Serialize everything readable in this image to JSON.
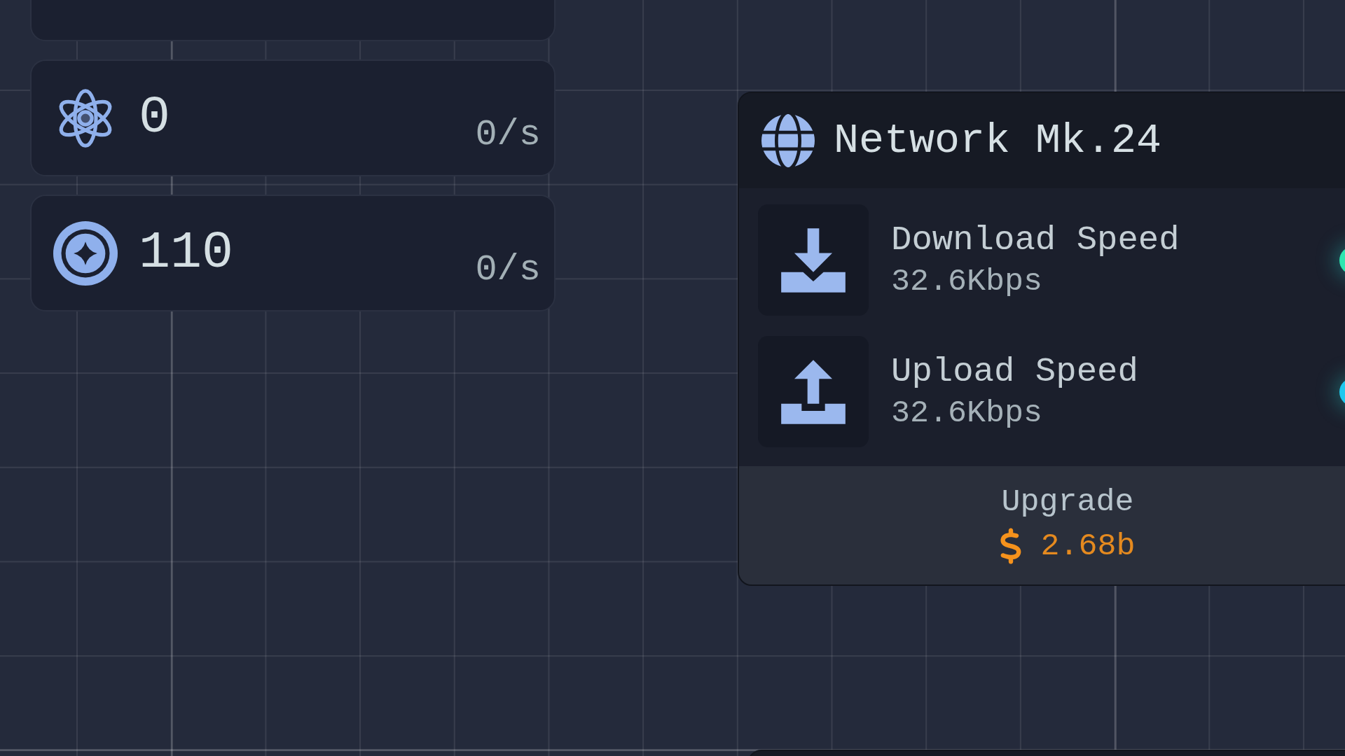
{
  "resources": [
    {
      "kind": "atom",
      "value": "0",
      "rate": "0/s"
    },
    {
      "kind": "ring",
      "value": "110",
      "rate": "0/s"
    }
  ],
  "network_card": {
    "title": "Network Mk.24",
    "stats": [
      {
        "kind": "download",
        "label": "Download Speed",
        "value": "32.6Kbps",
        "color": "#2ee6b0"
      },
      {
        "kind": "upload",
        "label": "Upload Speed",
        "value": "32.6Kbps",
        "color": "#1fc8ee"
      }
    ],
    "upgrade": {
      "label": "Upgrade",
      "price": "2.68b"
    }
  }
}
